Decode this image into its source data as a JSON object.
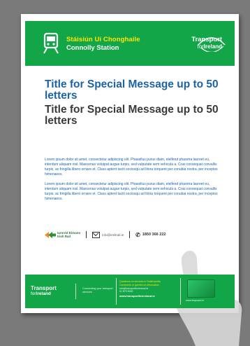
{
  "header": {
    "station_name_irish": "Stáisiún Uí Chonghaile",
    "station_name_english": "Connolly Station",
    "logo_line1": "Transport",
    "logo_line2_prefix": "for",
    "logo_line2_bold": "Ireland"
  },
  "message": {
    "title_english": "Title for Special Message up to 50 letters",
    "title_irish": "Title for Special Message up to 50 letters",
    "paragraph1": "Lorem ipsum dolor sit amet, consectetur adipiscing elit. Phasellus purus diam, eleifend pharetra laoreet eu, interdum aliquam nisl. Maecenas volutpat augue turpis, sed vulputate sem vehicula a. Cras consequat convallis turpis, ac fringilla libero ornare et. Class aptent taciti sociosqu ad litora torquent per conubia nostra, per inceptos himenaeos.",
    "paragraph2": "Lorem ipsum dolor sit amet, consectetur adipiscing elit. Phasellus purus diam, eleifend pharetra laoreet eu, interdum aliquam nisl. Maecenas volutpat augue turpis, sed vulputate sem vehicula a. Cras consequat convallis turpis, ac fringilla libero ornare et. Class aptent taciti sociosqu ad litora torquent per conubia nostra, per inceptos himenaeos."
  },
  "contact": {
    "operator_line1": "Iarnród Éireann",
    "operator_line2": "Irish Rail",
    "email": "info@irishrail.ie",
    "phone": "1850 366 222"
  },
  "footer": {
    "logo_line1": "Transport",
    "logo_line2_prefix": "for",
    "logo_line2_bold": "Ireland",
    "tagline": "Connecting your transport services",
    "info_heading_line1": "Questions on services in Dublin/public",
    "info_heading_line2": "Comments or queries on information",
    "info_line1": "info@transportforireland.ie",
    "info_line2": "01 879 8300",
    "website": "www.transportforireland.ie",
    "leap_url": "www.leapcard.ie"
  },
  "colors": {
    "brand_green": "#12a649",
    "title_blue": "#1b63a8",
    "irish_yellow": "#ffe600",
    "background_grey": "#7a7a7a"
  }
}
